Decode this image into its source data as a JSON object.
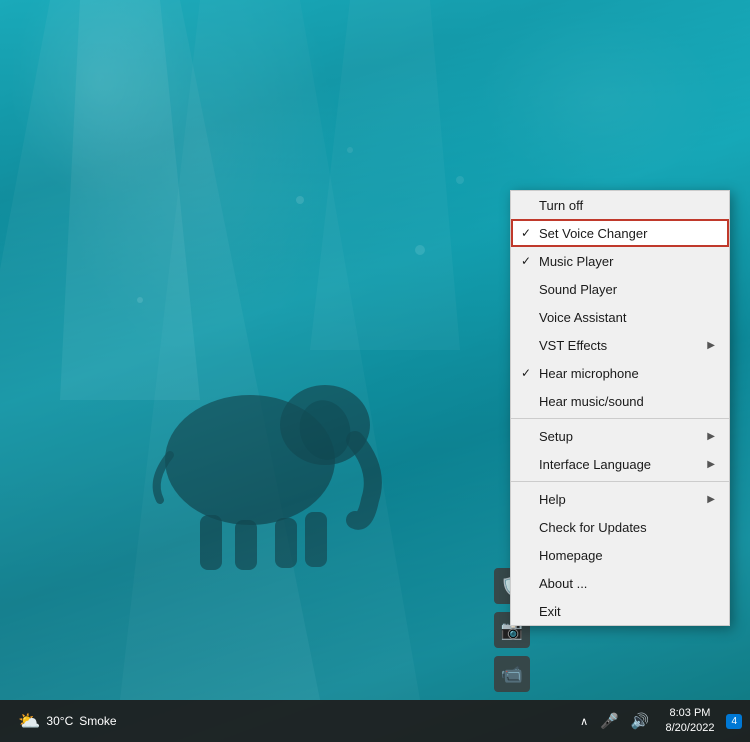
{
  "desktop": {
    "bg_description": "underwater teal ocean scene with elephant"
  },
  "tray_icons": [
    {
      "name": "shield-icon",
      "symbol": "🛡",
      "label": "Shield App"
    },
    {
      "name": "camera-icon",
      "symbol": "📷",
      "label": "Camera App"
    },
    {
      "name": "video-icon",
      "symbol": "📹",
      "label": "Video App"
    }
  ],
  "context_menu": {
    "items": [
      {
        "id": "turn-off",
        "label": "Turn off",
        "check": "",
        "has_arrow": false,
        "highlighted": false,
        "separator_after": false
      },
      {
        "id": "set-voice-changer",
        "label": "Set Voice Changer",
        "check": "✓",
        "has_arrow": false,
        "highlighted": true,
        "separator_after": false
      },
      {
        "id": "music-player",
        "label": "Music Player",
        "check": "✓",
        "has_arrow": false,
        "highlighted": false,
        "separator_after": false
      },
      {
        "id": "sound-player",
        "label": "Sound Player",
        "check": "",
        "has_arrow": false,
        "highlighted": false,
        "separator_after": false
      },
      {
        "id": "voice-assistant",
        "label": "Voice Assistant",
        "check": "",
        "has_arrow": false,
        "highlighted": false,
        "separator_after": false
      },
      {
        "id": "vst-effects",
        "label": "VST Effects",
        "check": "",
        "has_arrow": true,
        "highlighted": false,
        "separator_after": false
      },
      {
        "id": "hear-microphone",
        "label": "Hear microphone",
        "check": "✓",
        "has_arrow": false,
        "highlighted": false,
        "separator_after": false
      },
      {
        "id": "hear-music-sound",
        "label": "Hear music/sound",
        "check": "",
        "has_arrow": false,
        "highlighted": false,
        "separator_after": true
      },
      {
        "id": "setup",
        "label": "Setup",
        "check": "",
        "has_arrow": true,
        "highlighted": false,
        "separator_after": false
      },
      {
        "id": "interface-language",
        "label": "Interface Language",
        "check": "",
        "has_arrow": true,
        "highlighted": false,
        "separator_after": true
      },
      {
        "id": "help",
        "label": "Help",
        "check": "",
        "has_arrow": true,
        "highlighted": false,
        "separator_after": false
      },
      {
        "id": "check-updates",
        "label": "Check for Updates",
        "check": "",
        "has_arrow": false,
        "highlighted": false,
        "separator_after": false
      },
      {
        "id": "homepage",
        "label": "Homepage",
        "check": "",
        "has_arrow": false,
        "highlighted": false,
        "separator_after": false
      },
      {
        "id": "about",
        "label": "About ...",
        "check": "",
        "has_arrow": false,
        "highlighted": false,
        "separator_after": false
      },
      {
        "id": "exit",
        "label": "Exit",
        "check": "",
        "has_arrow": false,
        "highlighted": false,
        "separator_after": false
      }
    ]
  },
  "taskbar": {
    "weather": {
      "icon": "⛅",
      "temp": "30°C",
      "condition": "Smoke"
    },
    "tray": {
      "chevron": "^",
      "mic_icon": "🎤",
      "volume_icon": "🔊"
    },
    "clock": {
      "time": "8:03 PM",
      "date": "8/20/2022"
    },
    "notification_count": "4"
  }
}
